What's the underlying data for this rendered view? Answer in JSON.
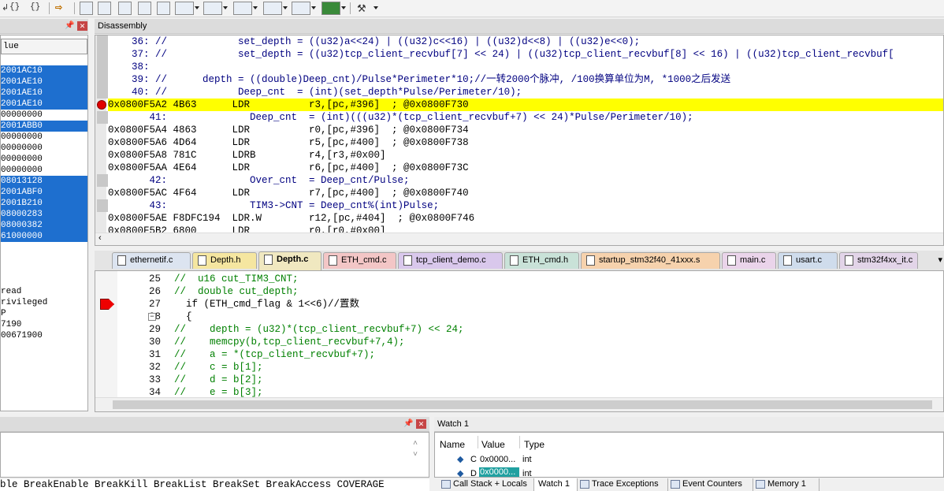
{
  "disasm": {
    "title": "Disassembly",
    "lines": [
      {
        "text": "    36: //            set_depth = ((u32)a<<24) | ((u32)c<<16) | ((u32)d<<8) | ((u32)e<<0);",
        "kind": "src"
      },
      {
        "text": "    37: //            set_depth = ((u32)tcp_client_recvbuf[7] << 24) | ((u32)tcp_client_recvbuf[8] << 16) | ((u32)tcp_client_recvbuf[",
        "kind": "src"
      },
      {
        "text": "    38:",
        "kind": "src"
      },
      {
        "text": "    39: //      depth = ((double)Deep_cnt)/Pulse*Perimeter*10;//一转2000个脉冲, /100换算单位为M, *1000之后发送",
        "kind": "src"
      },
      {
        "text": "    40: //            Deep_cnt  = (int)(set_depth*Pulse/Perimeter/10);",
        "kind": "src"
      },
      {
        "text": "0x0800F5A2 4B63      LDR          r3,[pc,#396]  ; @0x0800F730",
        "kind": "current"
      },
      {
        "text": "       41:              Deep_cnt  = (int)(((u32)*(tcp_client_recvbuf+7) << 24)*Pulse/Perimeter/10);",
        "kind": "src"
      },
      {
        "text": "0x0800F5A4 4863      LDR          r0,[pc,#396]  ; @0x0800F734",
        "kind": "asm"
      },
      {
        "text": "0x0800F5A6 4D64      LDR          r5,[pc,#400]  ; @0x0800F738",
        "kind": "asm"
      },
      {
        "text": "0x0800F5A8 781C      LDRB         r4,[r3,#0x00]",
        "kind": "asm"
      },
      {
        "text": "0x0800F5AA 4E64      LDR          r6,[pc,#400]  ; @0x0800F73C",
        "kind": "asm"
      },
      {
        "text": "       42:              Over_cnt  = Deep_cnt/Pulse;",
        "kind": "src"
      },
      {
        "text": "0x0800F5AC 4F64      LDR          r7,[pc,#400]  ; @0x0800F740",
        "kind": "asm"
      },
      {
        "text": "       43:              TIM3->CNT = Deep_cnt%(int)Pulse;",
        "kind": "src"
      },
      {
        "text": "0x0800F5AE F8DFC194  LDR.W        r12,[pc,#404]  ; @0x0800F746",
        "kind": "asm"
      },
      {
        "text": "0x0800F5B2 6800      LDR          r0,[r0,#0x00]",
        "kind": "asm"
      }
    ]
  },
  "registers": {
    "header": "lue",
    "rows": [
      {
        "v": "2001AC10",
        "sel": true
      },
      {
        "v": "2001AE10",
        "sel": true
      },
      {
        "v": "2001AE10",
        "sel": true
      },
      {
        "v": "2001AE10",
        "sel": true
      },
      {
        "v": "00000000",
        "sel": false
      },
      {
        "v": "2001ABB0",
        "sel": true
      },
      {
        "v": "00000000",
        "sel": false
      },
      {
        "v": "00000000",
        "sel": false
      },
      {
        "v": "00000000",
        "sel": false
      },
      {
        "v": "00000000",
        "sel": false
      },
      {
        "v": "08013128",
        "sel": true
      },
      {
        "v": "2001ABF0",
        "sel": true
      },
      {
        "v": "2001B210",
        "sel": true
      },
      {
        "v": "08000283",
        "sel": true
      },
      {
        "v": "08000382",
        "sel": true
      },
      {
        "v": "61000000",
        "sel": true
      }
    ],
    "status": [
      "read",
      "rivileged",
      "P",
      "7190",
      "00671900"
    ]
  },
  "tabs": [
    {
      "label": "ethernetif.c",
      "color": "#dce4f0",
      "active": false
    },
    {
      "label": "Depth.h",
      "color": "#f5e6a0",
      "active": false
    },
    {
      "label": "Depth.c",
      "color": "#f0e8c0",
      "active": true
    },
    {
      "label": "ETH_cmd.c",
      "color": "#f3c6c6",
      "active": false
    },
    {
      "label": "tcp_client_demo.c",
      "color": "#d9c8ec",
      "active": false
    },
    {
      "label": "ETH_cmd.h",
      "color": "#c9e2d8",
      "active": false
    },
    {
      "label": "startup_stm32f40_41xxx.s",
      "color": "#f6d2ad",
      "active": false
    },
    {
      "label": "main.c",
      "color": "#ead4ea",
      "active": false
    },
    {
      "label": "usart.c",
      "color": "#cfdcec",
      "active": false
    },
    {
      "label": "stm32f4xx_it.c",
      "color": "#e2d4e8",
      "active": false
    }
  ],
  "editor": {
    "lines": [
      {
        "n": "25",
        "text": "//  u16 cut_TIM3_CNT;",
        "kind": "comment"
      },
      {
        "n": "26",
        "text": "//  double cut_depth;",
        "kind": "comment"
      },
      {
        "n": "27",
        "text": "  if (ETH_cmd_flag & 1<<6)//置数",
        "kind": "code"
      },
      {
        "n": "28",
        "text": "  {",
        "kind": "code"
      },
      {
        "n": "29",
        "text": "//    depth = (u32)*(tcp_client_recvbuf+7) << 24;",
        "kind": "comment"
      },
      {
        "n": "30",
        "text": "//    memcpy(b,tcp_client_recvbuf+7,4);",
        "kind": "comment"
      },
      {
        "n": "31",
        "text": "//    a = *(tcp_client_recvbuf+7);",
        "kind": "comment"
      },
      {
        "n": "32",
        "text": "//    c = b[1];",
        "kind": "comment"
      },
      {
        "n": "33",
        "text": "//    d = b[2];",
        "kind": "comment"
      },
      {
        "n": "34",
        "text": "//    e = b[3];",
        "kind": "comment"
      }
    ]
  },
  "command": {
    "text": "ble BreakEnable BreakKill BreakList BreakSet BreakAccess COVERAGE"
  },
  "watch": {
    "title": "Watch 1",
    "col_name": "Name",
    "col_value": "Value",
    "col_type": "Type",
    "row1_name": "C",
    "row1_value": "0x0000...",
    "row1_type": "int",
    "row2_name": "D",
    "row2_value": "0x0000...",
    "row2_type": "int"
  },
  "bottom_tabs": [
    "Call Stack + Locals",
    "Watch 1",
    "Trace Exceptions",
    "Event Counters",
    "Memory 1"
  ],
  "toolbar": {
    "braces1": "{}",
    "braces2": "{}"
  }
}
